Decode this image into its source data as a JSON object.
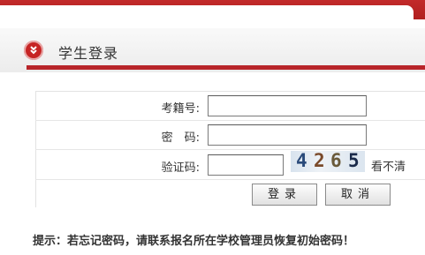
{
  "header": {
    "title": "学生登录"
  },
  "form": {
    "exam_id_label": "考籍号:",
    "password_label": "密　码:",
    "captcha_label": "验证码:",
    "exam_id_value": "",
    "password_value": "",
    "captcha_value": "",
    "captcha_digits": [
      "4",
      "2",
      "6",
      "5"
    ],
    "refresh_label": "看不清"
  },
  "buttons": {
    "login": "登录",
    "cancel": "取消"
  },
  "tip": "提示：若忘记密码，请联系报名所在学校管理员恢复初始密码！",
  "colors": {
    "brand_red": "#b8252a",
    "captcha_digit_colors": [
      "#2a4a7a",
      "#7a4a2a",
      "#6a5a3a",
      "#1a2a4a"
    ]
  }
}
